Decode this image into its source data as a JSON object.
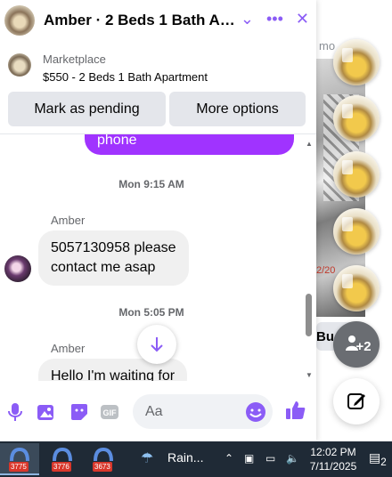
{
  "chat": {
    "title": "Amber · 2 Beds 1 Bath Apa...",
    "listing": {
      "label": "Marketplace",
      "price_title": "$550 - 2 Beds 1 Bath Apartment"
    },
    "actions": {
      "mark_pending": "Mark as pending",
      "more_options": "More options"
    },
    "messages": {
      "sent_partial": "phone",
      "timestamp_1": "Mon 9:15 AM",
      "sender_1": "Amber",
      "message_1_line1": "5057130958 please",
      "message_1_line2": "contact me asap",
      "timestamp_2": "Mon 5:05 PM",
      "sender_2": "Amber",
      "message_2_partial": "Hello I'm waiting for"
    },
    "composer": {
      "placeholder": "Aa"
    }
  },
  "background": {
    "more_text": "mo",
    "date_text": "2/20",
    "button_text": "Bu"
  },
  "chat_heads": {
    "overflow_count": "+2"
  },
  "taskbar": {
    "apps": [
      {
        "badge": "3775"
      },
      {
        "badge": "3776"
      },
      {
        "badge": "3673"
      }
    ],
    "weather": "Rain...",
    "time": "12:02 PM",
    "date": "7/11/2025",
    "notifications": "2"
  },
  "colors": {
    "accent": "#8b5cf6",
    "sent_bubble": "#a033ff",
    "received_bubble": "#f0f0f0",
    "messenger_blue": "#0866ff"
  }
}
